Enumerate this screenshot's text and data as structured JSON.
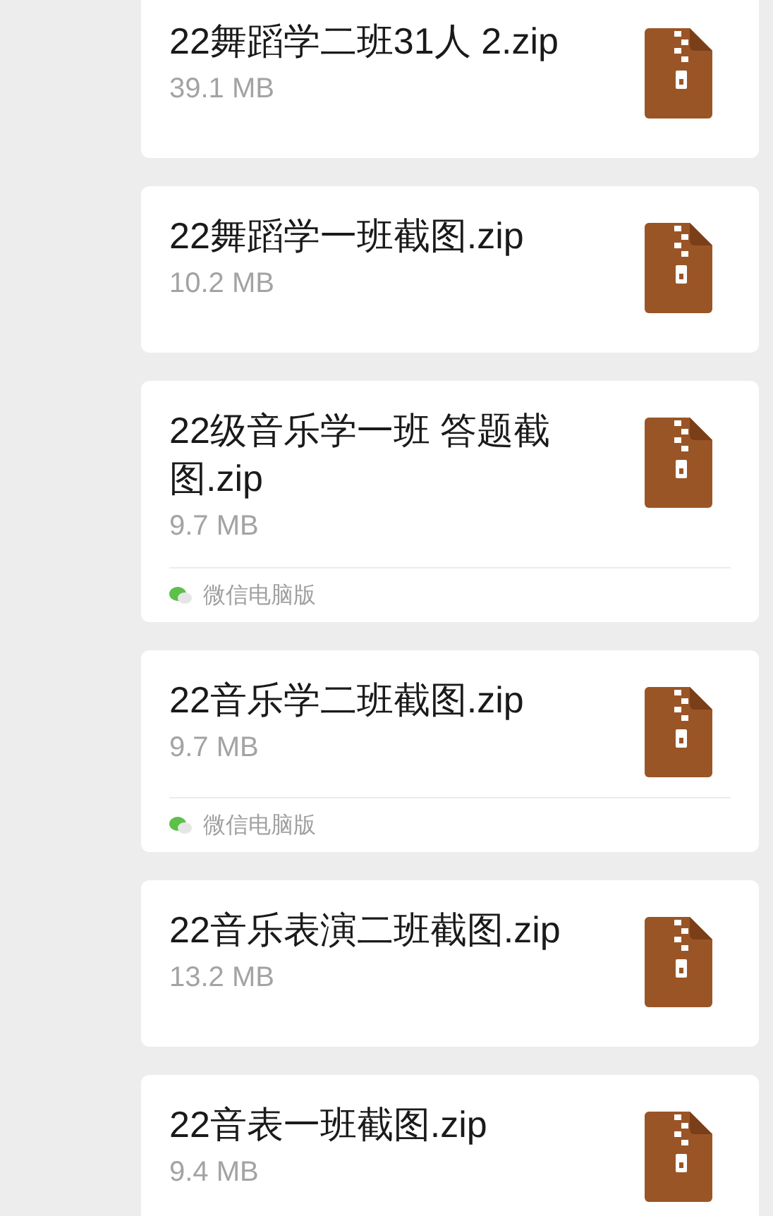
{
  "messages": [
    {
      "name": "22舞蹈学二班31人 2.zip",
      "size": "39.1 MB"
    },
    {
      "name": "22舞蹈学一班截图.zip",
      "size": "10.2 MB"
    },
    {
      "name": "22级音乐学一班 答题截图.zip",
      "size": "9.7 MB",
      "source": "微信电脑版"
    },
    {
      "name": "22音乐学二班截图.zip",
      "size": "9.7 MB",
      "source": "微信电脑版"
    },
    {
      "name": "22音乐表演二班截图.zip",
      "size": "13.2 MB"
    },
    {
      "name": "22音表一班截图.zip",
      "size": "9.4 MB"
    }
  ]
}
